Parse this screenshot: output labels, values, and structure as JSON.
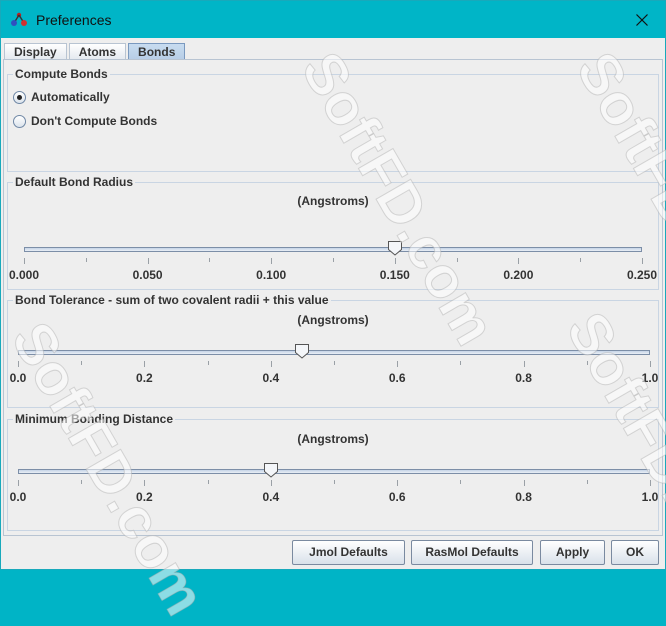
{
  "window": {
    "title": "Preferences"
  },
  "tabs": [
    {
      "label": "Display",
      "active": false
    },
    {
      "label": "Atoms",
      "active": false
    },
    {
      "label": "Bonds",
      "active": true
    }
  ],
  "compute_bonds": {
    "title": "Compute Bonds",
    "options": [
      {
        "label": "Automatically",
        "selected": true
      },
      {
        "label": "Don't Compute Bonds",
        "selected": false
      }
    ]
  },
  "bond_radius": {
    "title": "Default Bond Radius",
    "units": "(Angstroms)",
    "min": 0,
    "max": 0.25,
    "value": 0.15,
    "labels": [
      "0.000",
      "0.050",
      "0.100",
      "0.150",
      "0.200",
      "0.250"
    ]
  },
  "bond_tolerance": {
    "title": "Bond Tolerance - sum of two covalent radii + this value",
    "units": "(Angstroms)",
    "min": 0,
    "max": 1,
    "value": 0.45,
    "labels": [
      "0.0",
      "0.2",
      "0.4",
      "0.6",
      "0.8",
      "1.0"
    ]
  },
  "min_distance": {
    "title": "Minimum Bonding Distance",
    "units": "(Angstroms)",
    "min": 0,
    "max": 1,
    "value": 0.4,
    "labels": [
      "0.0",
      "0.2",
      "0.4",
      "0.6",
      "0.8",
      "1.0"
    ]
  },
  "buttons": {
    "jmol_defaults": "Jmol Defaults",
    "rasmol_defaults": "RasMol Defaults",
    "apply": "Apply",
    "ok": "OK"
  },
  "watermark": "SoftFD.com",
  "colors": {
    "titlebar": "#00b5c7",
    "tab_active": "#b6cde6"
  }
}
